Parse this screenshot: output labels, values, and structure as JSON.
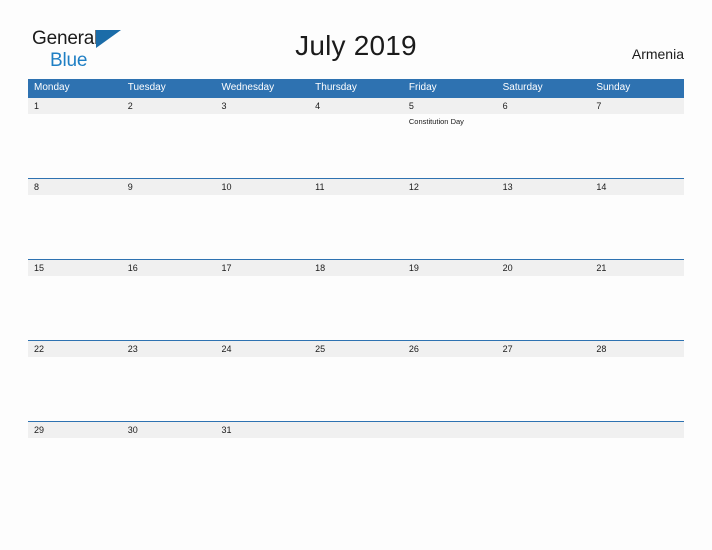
{
  "brand": {
    "name_part1": "General",
    "name_part2": "Blue",
    "triangle_color": "#1b6ca8",
    "blue_color": "#1f7fc4"
  },
  "header": {
    "title": "July 2019",
    "country": "Armenia"
  },
  "theme": {
    "header_blue": "#2e72b1",
    "band_gray": "#f0f0f0",
    "page_bg": "#fdfdfd",
    "text": "#1b1b1b"
  },
  "calendar": {
    "day_headers": [
      "Monday",
      "Tuesday",
      "Wednesday",
      "Thursday",
      "Friday",
      "Saturday",
      "Sunday"
    ],
    "weeks": [
      {
        "days": [
          {
            "num": "1",
            "events": []
          },
          {
            "num": "2",
            "events": []
          },
          {
            "num": "3",
            "events": []
          },
          {
            "num": "4",
            "events": []
          },
          {
            "num": "5",
            "events": [
              "Constitution Day"
            ]
          },
          {
            "num": "6",
            "events": []
          },
          {
            "num": "7",
            "events": []
          }
        ]
      },
      {
        "days": [
          {
            "num": "8",
            "events": []
          },
          {
            "num": "9",
            "events": []
          },
          {
            "num": "10",
            "events": []
          },
          {
            "num": "11",
            "events": []
          },
          {
            "num": "12",
            "events": []
          },
          {
            "num": "13",
            "events": []
          },
          {
            "num": "14",
            "events": []
          }
        ]
      },
      {
        "days": [
          {
            "num": "15",
            "events": []
          },
          {
            "num": "16",
            "events": []
          },
          {
            "num": "17",
            "events": []
          },
          {
            "num": "18",
            "events": []
          },
          {
            "num": "19",
            "events": []
          },
          {
            "num": "20",
            "events": []
          },
          {
            "num": "21",
            "events": []
          }
        ]
      },
      {
        "days": [
          {
            "num": "22",
            "events": []
          },
          {
            "num": "23",
            "events": []
          },
          {
            "num": "24",
            "events": []
          },
          {
            "num": "25",
            "events": []
          },
          {
            "num": "26",
            "events": []
          },
          {
            "num": "27",
            "events": []
          },
          {
            "num": "28",
            "events": []
          }
        ]
      },
      {
        "days": [
          {
            "num": "29",
            "events": []
          },
          {
            "num": "30",
            "events": []
          },
          {
            "num": "31",
            "events": []
          },
          {
            "num": "",
            "events": []
          },
          {
            "num": "",
            "events": []
          },
          {
            "num": "",
            "events": []
          },
          {
            "num": "",
            "events": []
          }
        ]
      }
    ]
  }
}
